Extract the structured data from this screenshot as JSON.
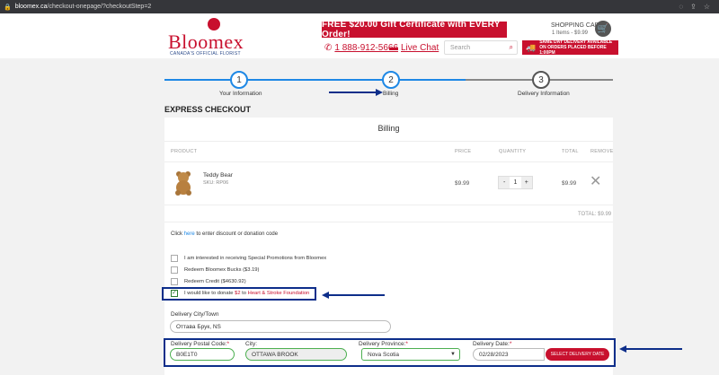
{
  "browser": {
    "url_domain": "bloomex.ca",
    "url_path": "/checkout-onepage/?checkoutStep=2"
  },
  "header": {
    "logo": "Bloomex",
    "tagline": "CANADA'S OFFICIAL FLORIST",
    "promo": "FREE $20.00 Gift Certificate with EVERY Order!",
    "phone": "1 888-912-5666",
    "live_chat": "Live Chat",
    "search_placeholder": "Search",
    "cart_title": "SHOPPING CART",
    "cart_summary": "1 Items - $9.99",
    "same_day": "SAME DAY DELIVERY AVAILABLE ON ORDERS PLACED BEFORE 1:00PM"
  },
  "steps": [
    {
      "num": "1",
      "label": "Your Information"
    },
    {
      "num": "2",
      "label": "Billing"
    },
    {
      "num": "3",
      "label": "Delivery Information"
    }
  ],
  "checkout": {
    "title": "EXPRESS CHECKOUT",
    "panel_title": "Billing",
    "columns": [
      "PRODUCT",
      "PRICE",
      "QUANTITY",
      "TOTAL",
      "REMOVE"
    ],
    "item": {
      "name": "Teddy Bear",
      "sku": "SKU: RP06",
      "price": "$9.99",
      "qty": "1",
      "total": "$9.99",
      "minus": "-",
      "plus": "+"
    },
    "grand_total": "TOTAL: $9.99",
    "discount_pre": "Click",
    "discount_link": "here",
    "discount_post": "to enter discount or donation code"
  },
  "options": [
    {
      "label": "I am interested in receiving Special Promotions from Bloomex",
      "checked": false
    },
    {
      "label": "Redeem Bloomex Bucks ($3.19)",
      "checked": false
    },
    {
      "label": "Redeem Credit ($4630.92)",
      "checked": false
    }
  ],
  "donation": {
    "pre": "I would like to donate",
    "amount": "$2",
    "mid": "to",
    "org": "Heart & Stroke Foundation",
    "checked": true
  },
  "delivery": {
    "city_town_label": "Delivery City/Town",
    "city_town_value": "Оттава Брук, NS",
    "postal_label": "Delivery Postal Code:",
    "postal_value": "B0E1T0",
    "city_label": "City:",
    "city_value": "OTTAWA BROOK",
    "province_label": "Delivery Province:",
    "province_value": "Nova Scotia",
    "date_label": "Delivery Date:",
    "date_value": "02/28/2023",
    "select_date": "SELECT DELIVERY DATE",
    "required_mark": "*"
  },
  "colors": {
    "brand_red": "#c8102e",
    "step_blue": "#1e88e5",
    "annotation_navy": "#0d2e8a"
  }
}
